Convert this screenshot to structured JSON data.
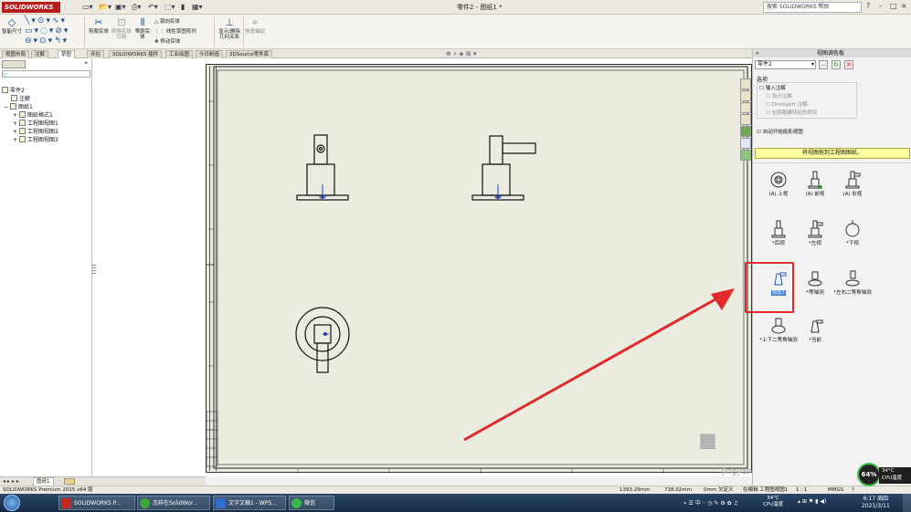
{
  "app": {
    "logo": "SOLIDWORKS",
    "document_title": "零件2 - 图纸1 *",
    "help_search_placeholder": "搜索 SOLIDWORKS 帮助",
    "window_controls": [
      "?",
      "-",
      "□",
      "×"
    ]
  },
  "ribbon": {
    "smart_dimension": "智能尺寸",
    "model_items": "模型项目",
    "spell_checker": "拼写检查器",
    "format_painter": "格式涂刷器",
    "note": "注释",
    "linear_note_pattern": "线性注释阵列",
    "balloon": "零件序号",
    "auto_balloon": "自动零件序号",
    "mirror_entities": "镜向实体",
    "linear_sketch_pattern": "线性草图阵列",
    "move_entities": "移动实体",
    "display_delete_relations": "显示/删除几何关系",
    "repair_sketch": "修复草图",
    "quick_snaps": "快速捕捉",
    "trim_entities": "剪裁实体",
    "convert_entities": "转换实体引用",
    "offset_entities": "等距实体"
  },
  "tabs": [
    "视图布局",
    "注解",
    "草图",
    "评估",
    "SOLIDWORKS 插件",
    "工业绘图",
    "今日制造",
    "3DSource零件库"
  ],
  "feature_tree": {
    "root": "零件2",
    "items": [
      "注解",
      "图纸1",
      "图纸格式1",
      "工程图视图1",
      "工程图视图2",
      "工程图视图3"
    ]
  },
  "sheet_tabs": [
    "图纸1"
  ],
  "task_pane": {
    "title": "视图调色板",
    "part_select": "零件2",
    "options_label": "选项",
    "checks": [
      {
        "label": "输入注解",
        "checked": false
      },
      {
        "label": "设计注解",
        "checked": false
      },
      {
        "label": "DimXpert 注解",
        "checked": false
      },
      {
        "label": "包括隐藏特征的项目",
        "checked": false
      },
      {
        "label": "自动开始投影视图",
        "checked": true
      }
    ],
    "drag_hint": "将视图拖到工程图图纸。",
    "views": [
      "(A) 上视",
      "(A) 前视",
      "(A) 右视",
      "*后视",
      "*左视",
      "*下视",
      "视图1",
      "*等轴测",
      "*左右二等角轴测",
      "*上下二等角轴测",
      "*当前"
    ],
    "selected_view": "视图1"
  },
  "status": {
    "app": "SOLIDWORKS Premium 2015 x64 版",
    "x": "1393.29mm",
    "y": "738.02mm",
    "z": "0mm",
    "state": "欠定义",
    "mode": "在编辑 工程图视图1",
    "scale": "1 : 1",
    "units": "MMGS",
    "help": "?"
  },
  "cpu": {
    "percent": "64%",
    "temp": "34°C",
    "label": "CPU温度"
  },
  "watermark": {
    "brand": "经验",
    "url": "jingyan.baidu.com"
  },
  "taskbar": {
    "items": [
      "SOLIDWORKS P...",
      "怎样在SolidWor...",
      "文字文稿1 - WPS...",
      "微信"
    ],
    "tray": [
      "中",
      "34°C",
      "CPU温度"
    ],
    "time": "6:17 周四",
    "date": "2021/3/11"
  },
  "colors": {
    "accent": "#1d4f91",
    "annotation_red": "#e0292b",
    "sheet": "#ecebe0",
    "highlight_yellow": "#ffffa0"
  }
}
